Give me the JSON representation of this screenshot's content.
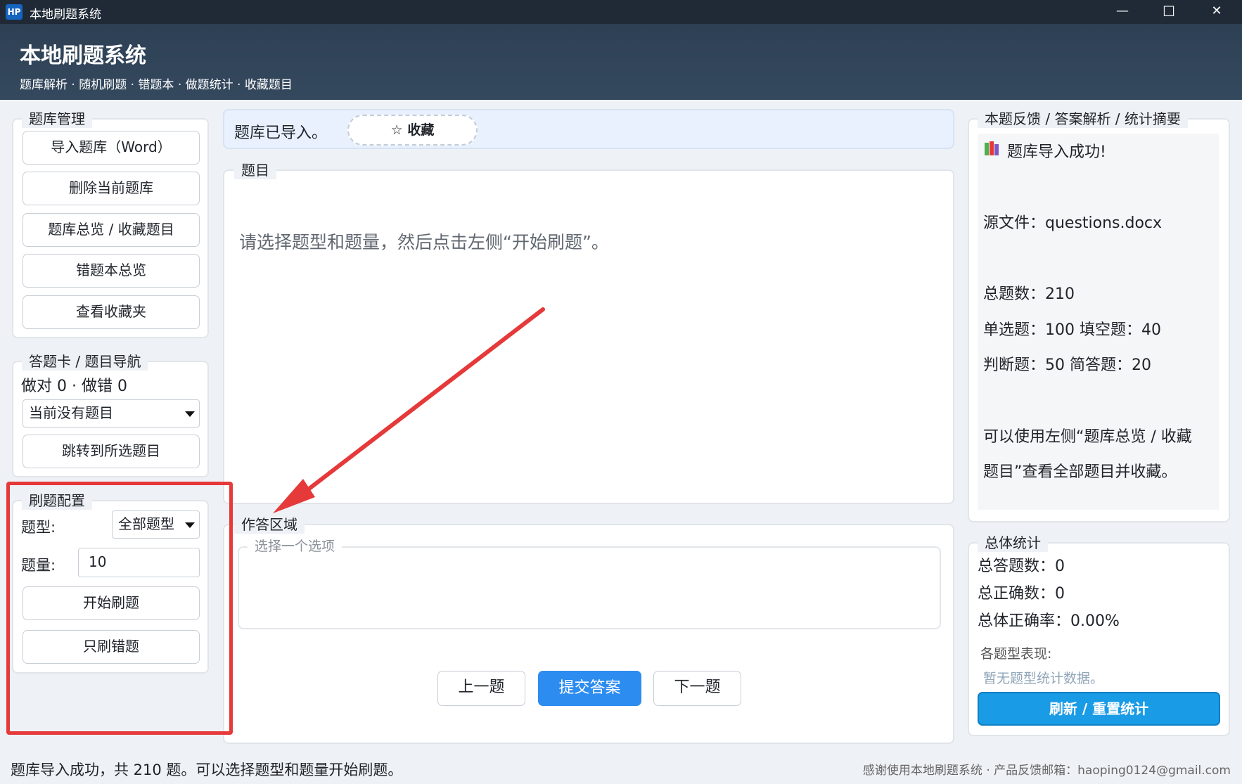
{
  "window": {
    "icon_text": "HP",
    "title": "本地刷题系统",
    "minimize": "—",
    "maximize": "☐",
    "close": "✕"
  },
  "header": {
    "title": "本地刷题系统",
    "subtitle": "题库解析 · 随机刷题 · 错题本 · 做题统计 · 收藏题目"
  },
  "library": {
    "legend": "题库管理",
    "buttons": [
      "导入题库（Word）",
      "删除当前题库",
      "题库总览 / 收藏题目",
      "错题本总览",
      "查看收藏夹"
    ]
  },
  "answer_card": {
    "legend": "答题卡 / 题目导航",
    "score": "做对 0 · 做错 0",
    "select_value": "当前没有题目",
    "jump_button": "跳转到所选题目"
  },
  "config": {
    "legend": "刷题配置",
    "type_label": "题型:",
    "type_value": "全部题型",
    "count_label": "题量:",
    "count_value": "10",
    "start_button": "开始刷题",
    "wrong_only_button": "只刷错题"
  },
  "status_bar": {
    "text": "题库已导入。",
    "favorite_button": "☆ 收藏"
  },
  "question": {
    "legend": "题目",
    "prompt": "请选择题型和题量，然后点击左侧“开始刷题”。"
  },
  "answer": {
    "legend": "作答区域",
    "options_legend": "选择一个选项",
    "prev_button": "上一题",
    "submit_button": "提交答案",
    "next_button": "下一题"
  },
  "feedback": {
    "legend": "本题反馈 / 答案解析 / 统计摘要",
    "icon": "books-icon",
    "success": "题库导入成功!",
    "source": "源文件：questions.docx",
    "total": "总题数：210",
    "line1": "单选题：100 填空题：40",
    "line2": "判断题：50 简答题：20",
    "hint1": "可以使用左侧“题库总览 / 收藏",
    "hint2": "题目”查看全部题目并收藏。"
  },
  "overall": {
    "legend": "总体统计",
    "answered": "总答题数：0",
    "correct": "总正确数：0",
    "rate": "总体正确率：0.00%",
    "by_type_label": "各题型表现:",
    "by_type_empty": "暂无题型统计数据。",
    "refresh_button": "刷新 / 重置统计"
  },
  "footer": {
    "left": "题库导入成功，共 210 题。可以选择题型和题量开始刷题。",
    "right": "感谢使用本地刷题系统 · 产品反馈邮箱：haoping0124@gmail.com"
  },
  "colors": {
    "accent": "#2d8cf0",
    "header": "#2f4357",
    "annotation": "#e5393a"
  }
}
